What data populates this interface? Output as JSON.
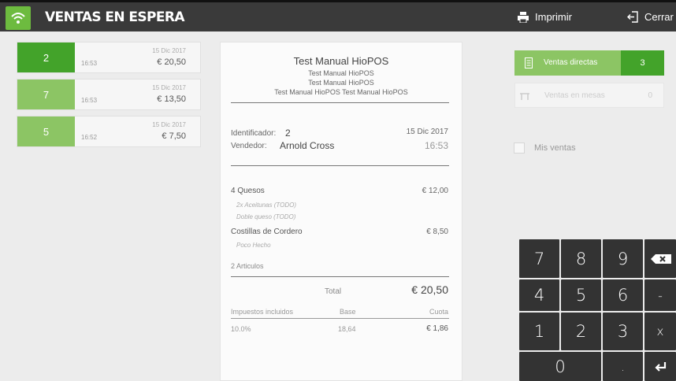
{
  "header": {
    "title": "VENTAS EN ESPERA",
    "print_label": "Imprimir",
    "close_label": "Cerrar"
  },
  "sales": [
    {
      "number": "2",
      "time": "16:53",
      "date": "15 Dic 2017",
      "amount": "€ 20,50",
      "color": "#43a32a"
    },
    {
      "number": "7",
      "time": "16:53",
      "date": "15 Dic 2017",
      "amount": "€ 13,50",
      "color": "#8cc564"
    },
    {
      "number": "5",
      "time": "16:52",
      "date": "15 Dic 2017",
      "amount": "€ 7,50",
      "color": "#8cc564"
    }
  ],
  "receipt": {
    "title": "Test Manual HioPOS",
    "subtitle_lines": [
      "Test Manual HioPOS",
      "Test Manual HioPOS",
      "Test Manual HioPOS Test Manual HioPOS"
    ],
    "id_label": "Identificador:",
    "id_value": "2",
    "date": "15 Dic 2017",
    "seller_label": "Vendedor:",
    "seller": "Arnold Cross",
    "time": "16:53",
    "items": [
      {
        "name": "4 Quesos",
        "price": "€ 12,00",
        "modifiers": [
          "2x Aceitunas (TODO)",
          "Doble queso (TODO)"
        ]
      },
      {
        "name": "Costillas de Cordero",
        "price": "€ 8,50",
        "modifiers": [
          "Poco Hecho"
        ]
      }
    ],
    "articles": "2 Articulos",
    "total_label": "Total",
    "total": "€ 20,50",
    "tax_header": {
      "label": "Impuestos incluidos",
      "base": "Base",
      "quota": "Cuota"
    },
    "tax_row": {
      "rate": "10.0%",
      "base": "18,64",
      "quota": "€ 1,86"
    }
  },
  "filters": {
    "direct_label": "Ventas directas",
    "direct_count": "3",
    "tables_label": "Ventas en mesas",
    "tables_count": "0",
    "my_sales_label": "Mis ventas"
  },
  "keypad": {
    "keys": [
      "7",
      "8",
      "9",
      "4",
      "5",
      "6",
      "-",
      "1",
      "2",
      "3",
      "x",
      "0",
      "."
    ]
  }
}
